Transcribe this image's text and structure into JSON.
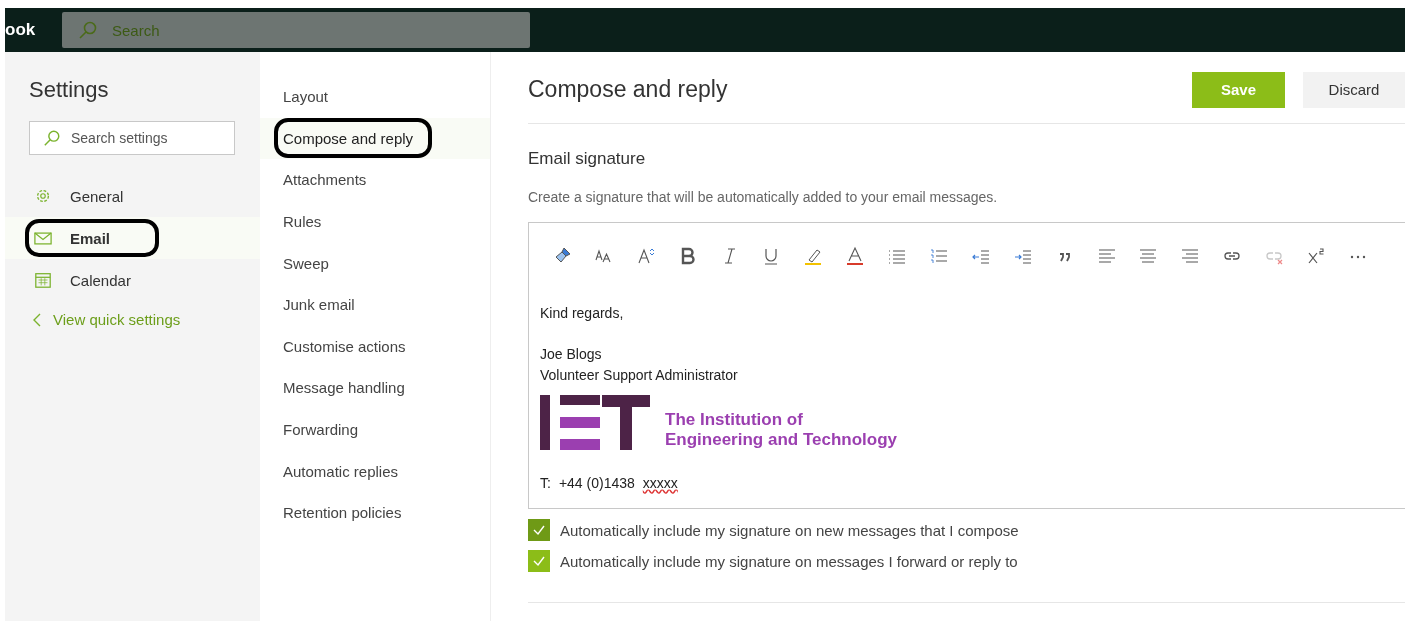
{
  "top_bar": {
    "app_name": "ook",
    "search": {
      "placeholder": "Search"
    }
  },
  "settings": {
    "title": "Settings",
    "search": {
      "placeholder": "Search settings"
    },
    "categories": [
      {
        "label": "General",
        "selected": false,
        "circled": false
      },
      {
        "label": "Email",
        "selected": true,
        "circled": true
      },
      {
        "label": "Calendar",
        "selected": false,
        "circled": false
      }
    ],
    "back_link": "View quick settings"
  },
  "subnav": [
    {
      "label": "Layout",
      "selected": false,
      "circled": false
    },
    {
      "label": "Compose and reply",
      "selected": true,
      "circled": true
    },
    {
      "label": "Attachments",
      "selected": false,
      "circled": false
    },
    {
      "label": "Rules",
      "selected": false,
      "circled": false
    },
    {
      "label": "Sweep",
      "selected": false,
      "circled": false
    },
    {
      "label": "Junk email",
      "selected": false,
      "circled": false
    },
    {
      "label": "Customise actions",
      "selected": false,
      "circled": false
    },
    {
      "label": "Message handling",
      "selected": false,
      "circled": false
    },
    {
      "label": "Forwarding",
      "selected": false,
      "circled": false
    },
    {
      "label": "Automatic replies",
      "selected": false,
      "circled": false
    },
    {
      "label": "Retention policies",
      "selected": false,
      "circled": false
    }
  ],
  "panel": {
    "title": "Compose and reply",
    "buttons": [
      {
        "label": "Save",
        "kind": "primary"
      },
      {
        "label": "Discard",
        "kind": "secondary"
      }
    ],
    "section_title": "Email signature",
    "description": "Create a signature that will be automatically added to your email messages.",
    "toolbar": [
      {
        "kind": "paint",
        "disabled": false
      },
      {
        "kind": "fontsize",
        "disabled": false
      },
      {
        "kind": "grow",
        "disabled": false
      },
      {
        "kind": "bold",
        "disabled": false
      },
      {
        "kind": "italic",
        "disabled": false
      },
      {
        "kind": "underline",
        "disabled": false
      },
      {
        "kind": "highlight",
        "disabled": false
      },
      {
        "kind": "fontcolor",
        "disabled": false
      },
      {
        "kind": "bullets",
        "disabled": false
      },
      {
        "kind": "numbering",
        "disabled": false
      },
      {
        "kind": "outdent",
        "disabled": false
      },
      {
        "kind": "indent",
        "disabled": false
      },
      {
        "kind": "quote",
        "disabled": false
      },
      {
        "kind": "alignleft",
        "disabled": false
      },
      {
        "kind": "aligncenter",
        "disabled": false
      },
      {
        "kind": "alignright",
        "disabled": false
      },
      {
        "kind": "link",
        "disabled": false
      },
      {
        "kind": "unlink",
        "disabled": true
      },
      {
        "kind": "superscript",
        "disabled": false
      },
      {
        "kind": "more",
        "disabled": false
      }
    ],
    "signature": {
      "closing": "Kind regards,",
      "name": "Joe Blogs",
      "role": "Volunteer Support Administrator",
      "logo_lines": [
        "The Institution of",
        "Engineering and Technology"
      ],
      "phone_label": "T:",
      "phone": "+44 (0)1438",
      "phone_masked": "xxxxx"
    },
    "options": [
      {
        "label": "Automatically include my signature on new messages that I compose",
        "checked": true
      },
      {
        "label": "Automatically include my signature on messages I forward or reply to",
        "checked": true
      }
    ]
  }
}
